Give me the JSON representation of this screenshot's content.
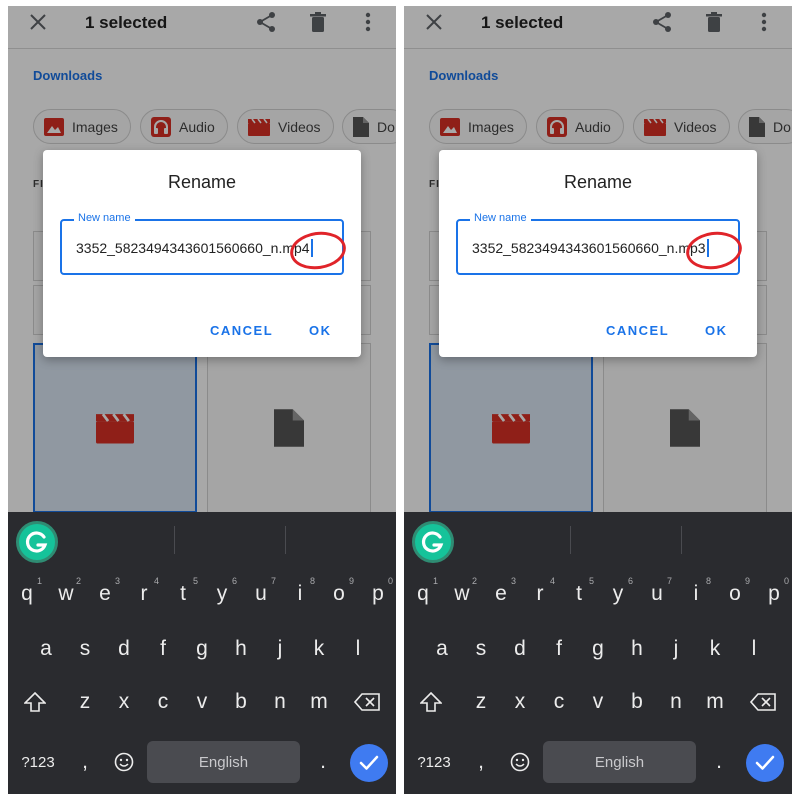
{
  "panels": [
    {
      "topbar": {
        "selected_text": "1 selected"
      },
      "breadcrumb": "Downloads",
      "chips": [
        {
          "label": "Images",
          "icon": "image-icon"
        },
        {
          "label": "Audio",
          "icon": "headphones-icon"
        },
        {
          "label": "Videos",
          "icon": "video-icon"
        },
        {
          "label": "Do",
          "icon": "document-icon"
        }
      ],
      "section_label": "FI",
      "dialog": {
        "title": "Rename",
        "field_label": "New name",
        "field_value": "3352_5823494343601560660_n.mp4",
        "cancel_label": "CANCEL",
        "ok_label": "OK"
      }
    },
    {
      "topbar": {
        "selected_text": "1 selected"
      },
      "breadcrumb": "Downloads",
      "chips": [
        {
          "label": "Images",
          "icon": "image-icon"
        },
        {
          "label": "Audio",
          "icon": "headphones-icon"
        },
        {
          "label": "Videos",
          "icon": "video-icon"
        },
        {
          "label": "Do",
          "icon": "document-icon"
        }
      ],
      "section_label": "FI",
      "dialog": {
        "title": "Rename",
        "field_label": "New name",
        "field_value": "3352_5823494343601560660_n.mp3",
        "cancel_label": "CANCEL",
        "ok_label": "OK"
      }
    }
  ],
  "keyboard": {
    "row1": [
      {
        "k": "q",
        "h": "1"
      },
      {
        "k": "w",
        "h": "2"
      },
      {
        "k": "e",
        "h": "3"
      },
      {
        "k": "r",
        "h": "4"
      },
      {
        "k": "t",
        "h": "5"
      },
      {
        "k": "y",
        "h": "6"
      },
      {
        "k": "u",
        "h": "7"
      },
      {
        "k": "i",
        "h": "8"
      },
      {
        "k": "o",
        "h": "9"
      },
      {
        "k": "p",
        "h": "0"
      }
    ],
    "row2": [
      "a",
      "s",
      "d",
      "f",
      "g",
      "h",
      "j",
      "k",
      "l"
    ],
    "row3": [
      "z",
      "x",
      "c",
      "v",
      "b",
      "n",
      "m"
    ],
    "symbols_label": "?123",
    "comma": ",",
    "period": ".",
    "space_label": "English"
  },
  "colors": {
    "accent": "#1a73e8",
    "annotation_circle": "#e0242a",
    "keyboard_bg": "#2a2b2f",
    "grammarly_green": "#15c39a",
    "done_key": "#3f7bf1"
  }
}
